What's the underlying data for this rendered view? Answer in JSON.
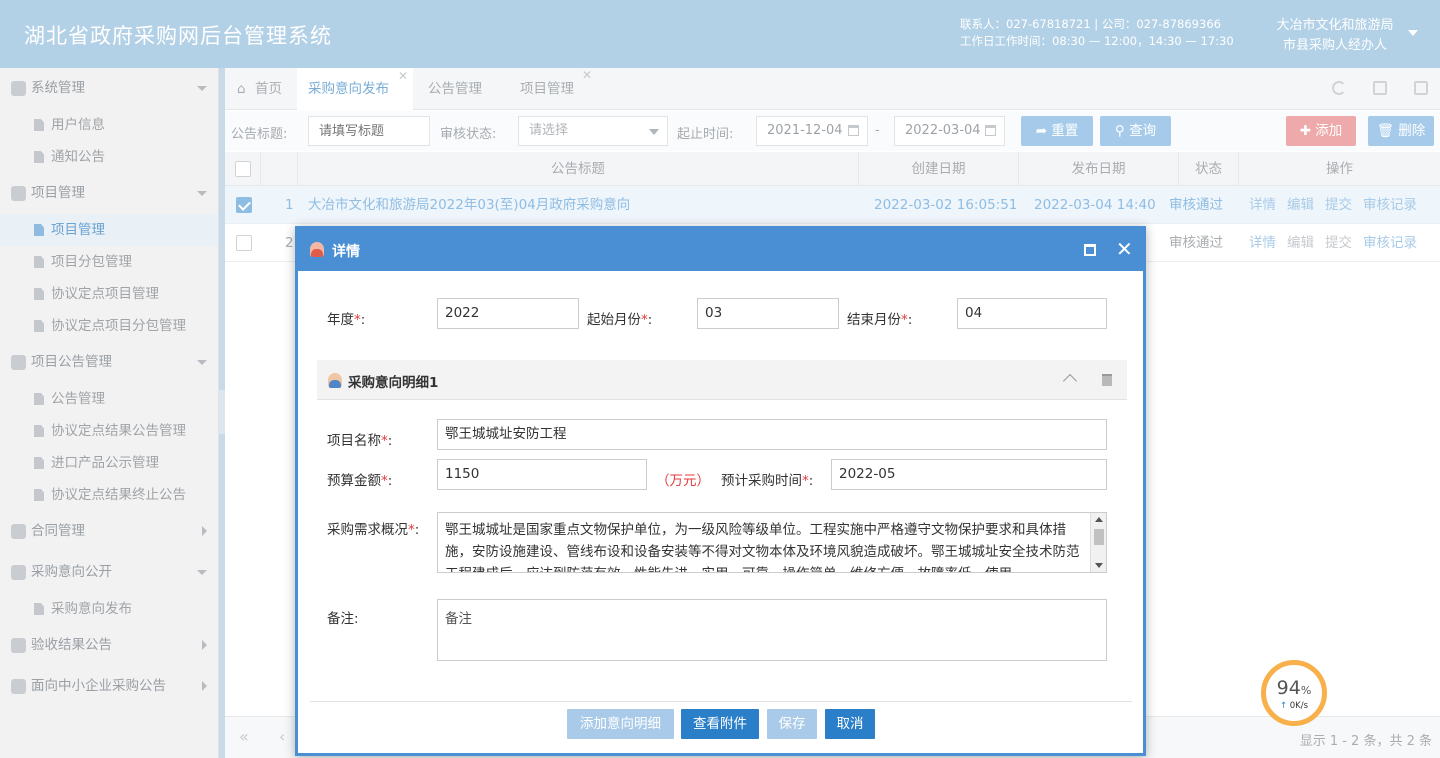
{
  "header": {
    "title": "湖北省政府采购网后台管理系统",
    "contact_line1": "联系人：027-67818721 | 公司：027-87869366",
    "contact_line2": "工作日工作时间：08:30 — 12:00，14:30 — 17:30",
    "org": "大冶市文化和旅游局",
    "role": "市县采购人经办人"
  },
  "sidebar": {
    "groups": [
      {
        "label": "系统管理",
        "items": [
          "用户信息",
          "通知公告"
        ]
      },
      {
        "label": "项目管理",
        "items": [
          "项目管理",
          "项目分包管理",
          "协议定点项目管理",
          "协议定点项目分包管理"
        ]
      },
      {
        "label": "项目公告管理",
        "items": [
          "公告管理",
          "协议定点结果公告管理",
          "进口产品公示管理",
          "协议定点结果终止公告"
        ]
      },
      {
        "label": "合同管理",
        "items": []
      },
      {
        "label": "采购意向公开",
        "items": [
          "采购意向发布"
        ]
      },
      {
        "label": "验收结果公告",
        "items": []
      },
      {
        "label": "面向中小企业采购公告",
        "items": []
      }
    ]
  },
  "tabs": [
    "首页",
    "采购意向发布",
    "公告管理",
    "项目管理"
  ],
  "search": {
    "title_label": "公告标题:",
    "title_placeholder": "请填写标题",
    "status_label": "审核状态:",
    "status_value": "请选择",
    "time_label": "起止时间:",
    "start_date": "2021-12-04",
    "separator": "-",
    "end_date": "2022-03-04",
    "reset": "重置",
    "query": "查询",
    "add": "添加",
    "delete": "删除"
  },
  "table": {
    "headers": [
      "公告标题",
      "创建日期",
      "发布日期",
      "状态",
      "操作"
    ],
    "rows": [
      {
        "no": "1",
        "title": "大冶市文化和旅游局2022年03(至)04月政府采购意向",
        "created": "2022-03-02 16:05:51",
        "published": "2022-03-04 14:40",
        "status": "审核通过"
      },
      {
        "no": "2",
        "title": "",
        "created": "",
        "published": "",
        "status": "审核通过"
      }
    ],
    "actions": [
      "详情",
      "编辑",
      "提交",
      "审核记录"
    ],
    "pager": "显示 1 - 2 条，共 2 条"
  },
  "dialog": {
    "title": "详情",
    "year_label": "年度",
    "year": "2022",
    "start_month_label": "起始月份",
    "start_month": "03",
    "end_month_label": "结束月份",
    "end_month": "04",
    "section_title": "采购意向明细1",
    "project_label": "项目名称",
    "project": "鄂王城城址安防工程",
    "budget_label": "预算金额",
    "budget": "1150",
    "unit": "（万元）",
    "plan_time_label": "预计采购时间",
    "plan_time": "2022-05",
    "req_label": "采购需求概况",
    "req_text": "鄂王城城址是国家重点文物保护单位，为一级风险等级单位。工程实施中严格遵守文物保护要求和具体措施，安防设施建设、管线布设和设备安装等不得对文物本体及环境风貌造成破坏。鄂王城城址安全技术防范工程建成后，应达到防范有效、性能先进、实用、可靠、操作简单、维修方便、故障率低、使用",
    "note_label": "备注:",
    "note_placeholder": "备注",
    "btn_add_detail": "添加意向明细",
    "btn_attachments": "查看附件",
    "btn_save": "保存",
    "btn_cancel": "取消"
  },
  "gauge": {
    "percent": "94",
    "percent_unit": "%",
    "speed": "0K/s"
  }
}
